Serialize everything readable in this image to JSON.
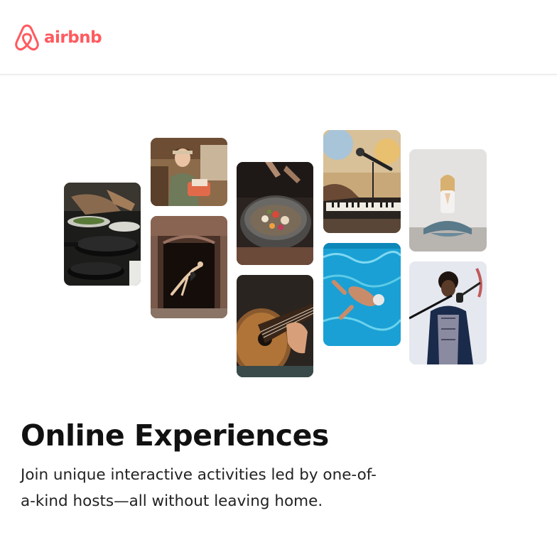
{
  "header": {
    "logo_text": "airbnb",
    "brand_color": "#FF5A5F"
  },
  "gallery": {
    "images": [
      {
        "subject": "cooking-pans"
      },
      {
        "subject": "woman-in-kitchen"
      },
      {
        "subject": "dancer-in-doorway"
      },
      {
        "subject": "bowl-of-food"
      },
      {
        "subject": "acoustic-guitar"
      },
      {
        "subject": "keyboard-and-microphone"
      },
      {
        "subject": "swimmer-in-pool"
      },
      {
        "subject": "yoga-meditation"
      },
      {
        "subject": "singer-with-microphone"
      }
    ]
  },
  "hero": {
    "title": "Online Experiences",
    "subtitle": "Join unique interactive activities led by one-of-a-kind hosts—all without leaving home."
  }
}
